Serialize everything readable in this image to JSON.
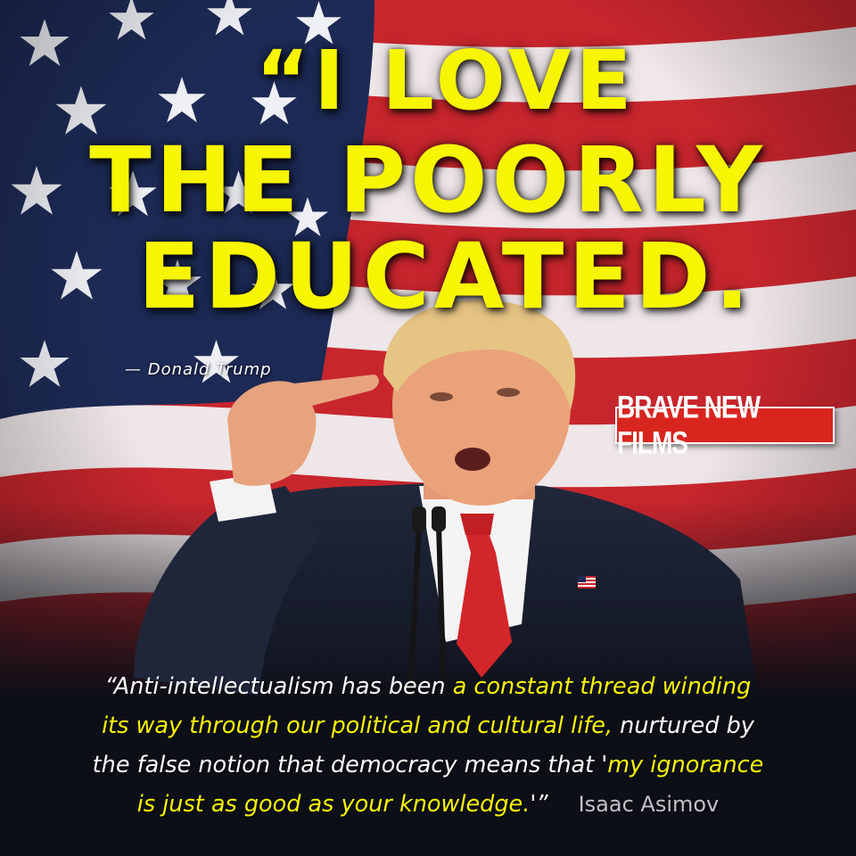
{
  "headline": {
    "line1": "“I LOVE",
    "line2": "THE POORLY",
    "line3": "EDUCATED."
  },
  "attribution": "— Donald Trump",
  "logo": {
    "text": "BRAVE NEW FILMS"
  },
  "quote": {
    "line1_a": "“Anti-intellectualism has been ",
    "line1_b": "a constant thread winding",
    "line2_a": "its way through our political and cultural life,",
    "line2_b": " nurtured by",
    "line3_a": "the false notion that democracy means that '",
    "line3_b": "my ignorance",
    "line4_a": "is just as good as your knowledge.",
    "line4_b": "'”",
    "author": "Isaac Asimov"
  },
  "colors": {
    "headline": "#f8f500",
    "flag_red": "#c8262d",
    "flag_blue": "#1d2a55",
    "logo_red": "#d8251e",
    "quote_highlight": "#f8f500",
    "bottom_band": "#0d0f16"
  },
  "icons": [
    "us-flag-background",
    "flag-lapel-pin-icon",
    "microphone-icon"
  ]
}
